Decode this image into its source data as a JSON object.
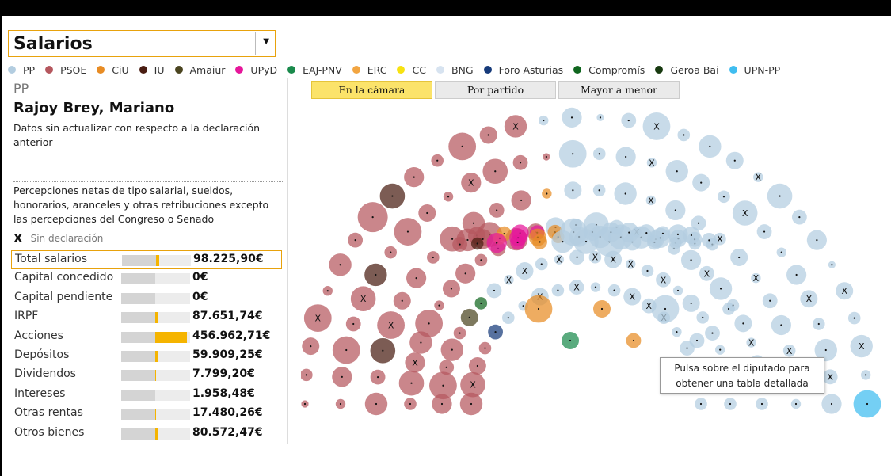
{
  "select": {
    "value": "Salarios"
  },
  "legend": [
    {
      "label": "PP",
      "color": "#b3cde0"
    },
    {
      "label": "PSOE",
      "color": "#b5575e"
    },
    {
      "label": "CiU",
      "color": "#e88c24"
    },
    {
      "label": "IU",
      "color": "#4a1d12"
    },
    {
      "label": "Amaiur",
      "color": "#4b4520"
    },
    {
      "label": "UPyD",
      "color": "#e6169a"
    },
    {
      "label": "EAJ-PNV",
      "color": "#1a8a4c"
    },
    {
      "label": "ERC",
      "color": "#f2a541"
    },
    {
      "label": "CC",
      "color": "#f7e210"
    },
    {
      "label": "BNG",
      "color": "#d7e3f0"
    },
    {
      "label": "Foro Asturias",
      "color": "#163a7a"
    },
    {
      "label": "Compromís",
      "color": "#10661f"
    },
    {
      "label": "Geroa Bai",
      "color": "#183a10"
    },
    {
      "label": "UPN-PP",
      "color": "#3fbdf0"
    }
  ],
  "deputy": {
    "party": "PP",
    "name": "Rajoy Brey, Mariano",
    "note": "Datos sin actualizar con respecto a la declaración anterior"
  },
  "description": "Percepciones netas de tipo salarial, sueldos, honorarios, aranceles y otras retribuciones excepto las percepciones del Congreso o Senado",
  "no_declaration": {
    "mark": "X",
    "label": "Sin declaración"
  },
  "rows": [
    {
      "label": "Total salarios",
      "value": "98.225,90€",
      "fill": 0.09,
      "selected": true
    },
    {
      "label": "Capital concedido",
      "value": "0€",
      "fill": 0,
      "selected": false
    },
    {
      "label": "Capital pendiente",
      "value": "0€",
      "fill": 0,
      "selected": false
    },
    {
      "label": "IRPF",
      "value": "87.651,74€",
      "fill": 0.09,
      "selected": false
    },
    {
      "label": "Acciones",
      "value": "456.962,71€",
      "fill": 0.9,
      "selected": false
    },
    {
      "label": "Depósitos",
      "value": "59.909,25€",
      "fill": 0.06,
      "selected": false
    },
    {
      "label": "Dividendos",
      "value": "7.799,20€",
      "fill": 0.02,
      "selected": false
    },
    {
      "label": "Intereses",
      "value": "1.958,48€",
      "fill": 0.01,
      "selected": false
    },
    {
      "label": "Otras rentas",
      "value": "17.480,26€",
      "fill": 0.03,
      "selected": false
    },
    {
      "label": "Otros bienes",
      "value": "80.572,47€",
      "fill": 0.09,
      "selected": false
    }
  ],
  "tabs": [
    {
      "label": "En la cámara",
      "active": true
    },
    {
      "label": "Por partido",
      "active": false
    },
    {
      "label": "Mayor a menor",
      "active": false
    }
  ],
  "tooltip": "Pulsa sobre el diputado para obtener una tabla detallada",
  "hemicycle": {
    "no_declaration_mark": "X",
    "rings": [
      {
        "seats": [
          "PSOE",
          "PSOE",
          "PSOE",
          "PSOE",
          "PSOE",
          "PSOE",
          "PSOE",
          "PSOE",
          "IU",
          "PSOE",
          "PSOE",
          "PSOE",
          "PSOE",
          "PSOE",
          "PP",
          "PP",
          "PP",
          "PP",
          "PP",
          "PP",
          "PP",
          "PP",
          "PP",
          "PP",
          "PP",
          "PP",
          "PP",
          "PP",
          "PP",
          "PP",
          "PP",
          "UPN-PP"
        ],
        "sizes": [
          0.1,
          0.3,
          0.5,
          0.9,
          0.2,
          0.7,
          0.4,
          1.0,
          0.8,
          0.6,
          0.3,
          0.9,
          0.5,
          0.7,
          0.2,
          0.6,
          0.1,
          0.4,
          0.9,
          0.3,
          0.7,
          0.5,
          0.2,
          0.8,
          0.4,
          0.6,
          0.1,
          0.5,
          0.3,
          0.7,
          0.2,
          0.9
        ],
        "nodecl": [
          3,
          13,
          18,
          22,
          27,
          29
        ]
      },
      {
        "seats": [
          "PSOE",
          "PSOE",
          "PSOE",
          "PSOE",
          "PSOE",
          "IU",
          "PSOE",
          "PSOE",
          "PSOE",
          "PSOE",
          "PSOE",
          "PSOE",
          "PSOE",
          "PSOE",
          "PP",
          "PP",
          "PP",
          "PP",
          "PP",
          "PP",
          "PP",
          "PP",
          "PP",
          "PP",
          "PP",
          "PP",
          "PP",
          "PP",
          "PP",
          "PP"
        ],
        "sizes": [
          0.2,
          0.6,
          0.9,
          0.4,
          0.8,
          0.7,
          0.3,
          0.9,
          0.5,
          0.2,
          0.6,
          0.8,
          0.4,
          0.1,
          0.9,
          0.3,
          0.6,
          0.2,
          0.7,
          0.5,
          0.3,
          0.8,
          0.4,
          0.2,
          0.6,
          0.5,
          0.3,
          0.7,
          0.4,
          0.6
        ],
        "nodecl": [
          4,
          10,
          17,
          21,
          25,
          28
        ]
      },
      {
        "seats": [
          "PSOE",
          "PSOE",
          "IU",
          "PSOE",
          "PSOE",
          "PSOE",
          "PSOE",
          "PSOE",
          "PSOE",
          "PSOE",
          "PSOE",
          "CiU",
          "PP",
          "PP",
          "PP",
          "PP",
          "PP",
          "PP",
          "PP",
          "PP",
          "PP",
          "PP",
          "PP",
          "PP",
          "PP",
          "PP"
        ],
        "sizes": [
          0.7,
          0.4,
          0.8,
          0.9,
          0.5,
          0.6,
          0.3,
          0.8,
          0.7,
          0.4,
          0.6,
          0.2,
          0.5,
          0.3,
          0.7,
          0.2,
          0.6,
          0.4,
          0.3,
          0.5,
          0.2,
          0.4,
          0.6,
          0.3,
          0.5,
          0.2
        ],
        "nodecl": [
          3,
          15,
          18,
          20,
          23
        ]
      },
      {
        "seats": [
          "PSOE",
          "PSOE",
          "PSOE",
          "PSOE",
          "PSOE",
          "PSOE",
          "PSOE",
          "PSOE",
          "PSOE",
          "PSOE",
          "PSOE",
          "PSOE",
          "PP",
          "PP",
          "PP",
          "PP",
          "PP",
          "PP",
          "PP",
          "PP",
          "PP",
          "PP",
          "PP",
          "PP",
          "PP",
          "PP",
          "PP",
          "PP"
        ],
        "sizes": [
          0.3,
          0.8,
          0.6,
          0.7,
          0.9,
          0.2,
          0.5,
          0.6,
          0.3,
          0.4,
          0.7,
          0.5,
          0.6,
          0.3,
          0.8,
          0.4,
          0.2,
          0.5,
          0.3,
          0.6,
          0.4,
          0.7,
          0.3,
          0.5,
          0.2,
          0.4,
          0.6,
          0.3
        ],
        "nodecl": [
          2,
          16,
          20,
          24
        ]
      },
      {
        "seats": [
          "PSOE",
          "PSOE",
          "PSOE",
          "PSOE",
          "PSOE",
          "Amaiur",
          "Compromís",
          "PP",
          "PP",
          "PP",
          "PP",
          "PP",
          "PP",
          "PP",
          "PP",
          "PP",
          "PP",
          "PP",
          "PP",
          "PP",
          "PP",
          "PP",
          "PP",
          "PP",
          "PP",
          "PP"
        ],
        "sizes": [
          0.6,
          0.9,
          0.4,
          0.7,
          0.3,
          0.5,
          0.3,
          0.4,
          0.2,
          0.5,
          0.3,
          0.2,
          0.4,
          0.3,
          0.5,
          0.2,
          0.3,
          0.4,
          0.2,
          0.5,
          0.3,
          0.4,
          0.2,
          0.3,
          0.4,
          0.3
        ],
        "nodecl": [
          8,
          9,
          11,
          13,
          14,
          15,
          17
        ]
      },
      {
        "seats": [
          "PSOE",
          "PSOE",
          "PSOE",
          "PSOE",
          "Foro Asturias",
          "PP",
          "PP",
          "PP",
          "PP",
          "PP",
          "PP",
          "PP",
          "PP",
          "PP",
          "PP",
          "PP",
          "PP",
          "PP",
          "PP",
          "PP"
        ],
        "sizes": [
          0.7,
          0.8,
          0.5,
          0.3,
          0.4,
          0.3,
          0.2,
          0.5,
          0.3,
          0.4,
          0.2,
          0.3,
          0.5,
          0.4,
          0.3,
          0.2,
          0.4,
          0.3,
          0.2,
          0.3
        ],
        "nodecl": [
          1,
          7,
          9,
          12,
          13,
          14
        ]
      }
    ],
    "inner_block": {
      "seats": [
        "PSOE",
        "PSOE",
        "PSOE",
        "PSOE",
        "PSOE",
        "IU",
        "CiU",
        "ERC",
        "UPyD",
        "UPyD",
        "UPyD",
        "UPyD",
        "UPyD",
        "CiU",
        "CiU",
        "CiU",
        "CiU",
        "PP",
        "PP",
        "PP",
        "PP",
        "PP",
        "PP",
        "PP",
        "PP",
        "PP",
        "PP",
        "PP",
        "PP",
        "PP",
        "PP",
        "PP",
        "PP",
        "PP",
        "PP",
        "PP",
        "PP",
        "PP",
        "PP",
        "PP",
        "PP"
      ],
      "sizes": [
        0.5,
        0.7,
        0.4,
        0.8,
        0.6,
        0.3,
        0.4,
        0.3,
        0.6,
        0.5,
        0.5,
        0.4,
        0.4,
        0.5,
        0.4,
        0.4,
        0.3,
        0.7,
        0.9,
        0.6,
        0.8,
        0.5,
        0.7,
        1.0,
        0.6,
        0.8,
        0.5,
        0.6,
        0.7,
        0.4,
        0.5,
        0.6,
        0.3,
        0.4,
        0.5,
        0.3,
        0.6,
        0.4,
        0.3,
        0.5,
        0.4
      ]
    },
    "center_seats": [
      {
        "party": "CiU",
        "size": 0.9
      },
      {
        "party": "EAJ-PNV",
        "size": 0.5
      },
      {
        "party": "CiU",
        "size": 0.5
      },
      {
        "party": "CiU",
        "size": 0.4
      },
      {
        "party": "PP",
        "size": 0.9
      },
      {
        "party": "PP",
        "size": 0.4
      },
      {
        "party": "PP",
        "size": 0.3
      }
    ]
  }
}
